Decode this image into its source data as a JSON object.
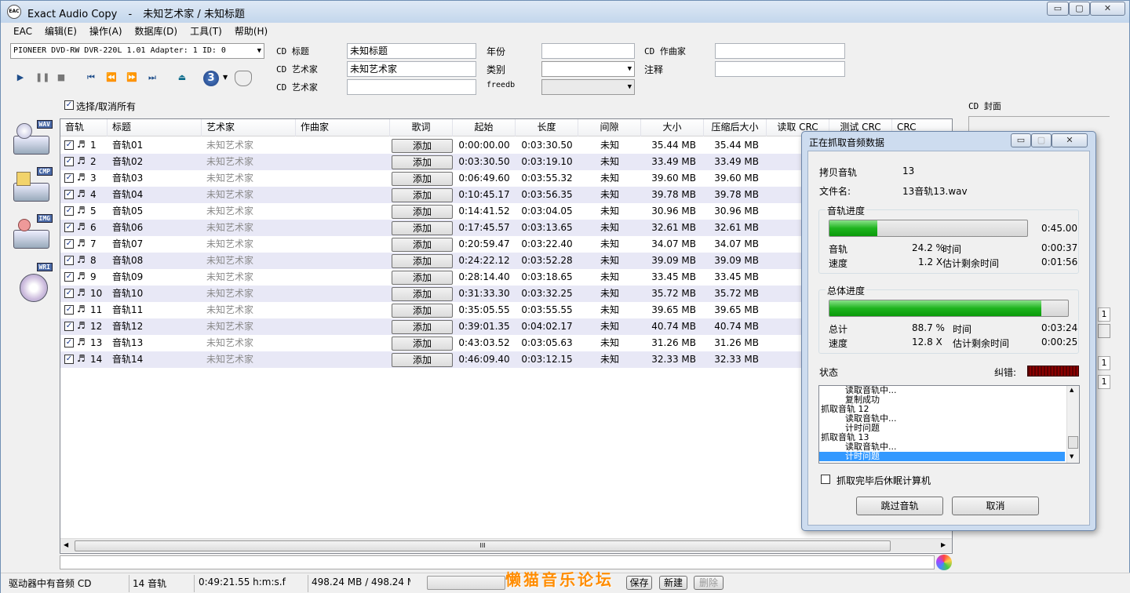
{
  "window": {
    "app_name": "Exact Audio Copy",
    "separator": "-",
    "doc_title": "未知艺术家 / 未知标题",
    "icon_text": "EAC",
    "min_label": "▭",
    "max_label": "▢",
    "close_label": "✕"
  },
  "menu": [
    "EAC",
    "编辑(E)",
    "操作(A)",
    "数据库(D)",
    "工具(T)",
    "帮助(H)"
  ],
  "drive": {
    "selected": "PIONEER DVD-RW  DVR-220L 1.01  Adapter: 1  ID: 0"
  },
  "toolbar": {
    "speed_value": "3"
  },
  "cd_info": {
    "title_label": "CD 标题",
    "title_value": "未知标题",
    "artist_label": "CD 艺术家",
    "artist_value": "未知艺术家",
    "artist2_label": "CD 艺术家",
    "artist2_value": "",
    "year_label": "年份",
    "year_value": "",
    "genre_label": "类别",
    "genre_value": "",
    "freedb_label": "freedb",
    "freedb_value": "",
    "composer_label": "CD 作曲家",
    "composer_value": "",
    "comment_label": "注释",
    "comment_value": "",
    "cover_label": "CD 封面"
  },
  "select_all_label": "选择/取消所有",
  "columns": [
    "音轨",
    "标题",
    "艺术家",
    "作曲家",
    "歌词",
    "起始",
    "长度",
    "间隙",
    "大小",
    "压缩后大小",
    "读取 CRC",
    "测试 CRC",
    "CRC"
  ],
  "add_label": "添加",
  "tracks": [
    {
      "n": "1",
      "title": "音轨01",
      "artist": "未知艺术家",
      "start": "0:00:00.00",
      "len": "0:03:30.50",
      "gap": "未知",
      "size": "35.44 MB",
      "csize": "35.44 MB"
    },
    {
      "n": "2",
      "title": "音轨02",
      "artist": "未知艺术家",
      "start": "0:03:30.50",
      "len": "0:03:19.10",
      "gap": "未知",
      "size": "33.49 MB",
      "csize": "33.49 MB"
    },
    {
      "n": "3",
      "title": "音轨03",
      "artist": "未知艺术家",
      "start": "0:06:49.60",
      "len": "0:03:55.32",
      "gap": "未知",
      "size": "39.60 MB",
      "csize": "39.60 MB"
    },
    {
      "n": "4",
      "title": "音轨04",
      "artist": "未知艺术家",
      "start": "0:10:45.17",
      "len": "0:03:56.35",
      "gap": "未知",
      "size": "39.78 MB",
      "csize": "39.78 MB"
    },
    {
      "n": "5",
      "title": "音轨05",
      "artist": "未知艺术家",
      "start": "0:14:41.52",
      "len": "0:03:04.05",
      "gap": "未知",
      "size": "30.96 MB",
      "csize": "30.96 MB"
    },
    {
      "n": "6",
      "title": "音轨06",
      "artist": "未知艺术家",
      "start": "0:17:45.57",
      "len": "0:03:13.65",
      "gap": "未知",
      "size": "32.61 MB",
      "csize": "32.61 MB"
    },
    {
      "n": "7",
      "title": "音轨07",
      "artist": "未知艺术家",
      "start": "0:20:59.47",
      "len": "0:03:22.40",
      "gap": "未知",
      "size": "34.07 MB",
      "csize": "34.07 MB"
    },
    {
      "n": "8",
      "title": "音轨08",
      "artist": "未知艺术家",
      "start": "0:24:22.12",
      "len": "0:03:52.28",
      "gap": "未知",
      "size": "39.09 MB",
      "csize": "39.09 MB"
    },
    {
      "n": "9",
      "title": "音轨09",
      "artist": "未知艺术家",
      "start": "0:28:14.40",
      "len": "0:03:18.65",
      "gap": "未知",
      "size": "33.45 MB",
      "csize": "33.45 MB"
    },
    {
      "n": "10",
      "title": "音轨10",
      "artist": "未知艺术家",
      "start": "0:31:33.30",
      "len": "0:03:32.25",
      "gap": "未知",
      "size": "35.72 MB",
      "csize": "35.72 MB"
    },
    {
      "n": "11",
      "title": "音轨11",
      "artist": "未知艺术家",
      "start": "0:35:05.55",
      "len": "0:03:55.55",
      "gap": "未知",
      "size": "39.65 MB",
      "csize": "39.65 MB"
    },
    {
      "n": "12",
      "title": "音轨12",
      "artist": "未知艺术家",
      "start": "0:39:01.35",
      "len": "0:04:02.17",
      "gap": "未知",
      "size": "40.74 MB",
      "csize": "40.74 MB"
    },
    {
      "n": "13",
      "title": "音轨13",
      "artist": "未知艺术家",
      "start": "0:43:03.52",
      "len": "0:03:05.63",
      "gap": "未知",
      "size": "31.26 MB",
      "csize": "31.26 MB"
    },
    {
      "n": "14",
      "title": "音轨14",
      "artist": "未知艺术家",
      "start": "0:46:09.40",
      "len": "0:03:12.15",
      "gap": "未知",
      "size": "32.33 MB",
      "csize": "32.33 MB"
    }
  ],
  "side_icons": [
    "WAV",
    "CMP",
    "IMG",
    "WRI"
  ],
  "scroll_grip": "III",
  "dialog": {
    "title": "正在抓取音频数据",
    "copy_track_label": "拷贝音轨",
    "copy_track_value": "13",
    "filename_label": "文件名:",
    "filename_value": "13音轨13.wav",
    "track_progress_label": "音轨进度",
    "track_progress": 24.2,
    "track_total_time": "0:45.00",
    "track_label": "音轨",
    "track_percent": "24.2 %",
    "time_label": "时间",
    "track_time": "0:00:37",
    "speed_label": "速度",
    "track_speed": "1.2 X",
    "remain_label": "估计剩余时间",
    "track_remain": "0:01:56",
    "overall_label": "总体进度",
    "overall_progress": 88.7,
    "total_label": "总计",
    "total_percent": "88.7 %",
    "total_time_label": "时间",
    "total_time": "0:03:24",
    "total_speed_label": "速度",
    "total_speed": "12.8 X",
    "total_remain_label": "估计剩余时间",
    "total_remain": "0:00:25",
    "status_label": "状态",
    "error_label": "纠错:",
    "log": [
      "读取音轨中...",
      "复制成功",
      "抓取音轨 12",
      "读取音轨中...",
      "计时问题",
      "抓取音轨 13",
      "读取音轨中...",
      "计时问题"
    ],
    "sleep_label": "抓取完毕后休眠计算机",
    "skip_button": "跳过音轨",
    "cancel_button": "取消"
  },
  "right_side_values": [
    "1",
    "1",
    "1"
  ],
  "statusbar": {
    "disc_type": "驱动器中有音频 CD",
    "track_count": "14 音轨",
    "total_length": "0:49:21.55 h:m:s.f",
    "total_size": "498.24 MB / 498.24 M",
    "save": "保存",
    "new": "新建",
    "delete": "删除"
  },
  "watermark": "懒猫音乐论坛",
  "colors": {
    "progress_green": "#1eb41e",
    "log_highlight": "#3399ff",
    "watermark": "#ff8c00"
  }
}
